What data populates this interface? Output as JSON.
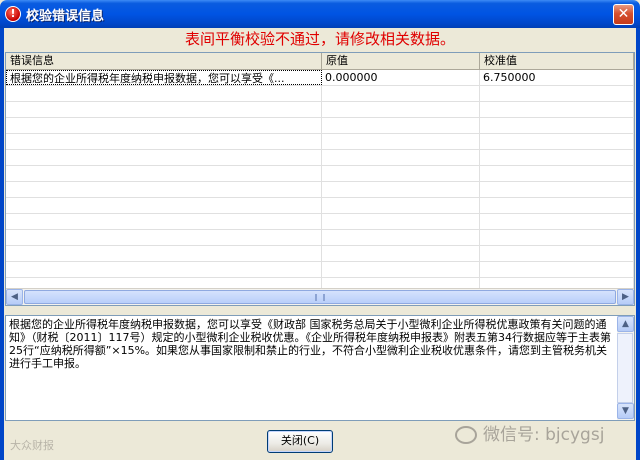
{
  "window": {
    "title": "校验错误信息",
    "icon": "error-icon",
    "close_glyph": "✕"
  },
  "headline": "表间平衡校验不通过，请修改相关数据。",
  "table": {
    "columns": [
      "错误信息",
      "原值",
      "校准值"
    ],
    "rows": [
      [
        "根据您的企业所得税年度纳税申报数据，您可以享受《...",
        "0.000000",
        "6.750000"
      ]
    ]
  },
  "scrollbar": {
    "left_glyph": "◀",
    "right_glyph": "▶",
    "up_glyph": "▲",
    "down_glyph": "▼",
    "grip": "|||"
  },
  "detail_text": "根据您的企业所得税年度纳税申报数据，您可以享受《财政部 国家税务总局关于小型微利企业所得税优惠政策有关问题的通知》（财税〔2011〕117号）规定的小型微利企业税收优惠。《企业所得税年度纳税申报表》附表五第34行数据应等于主表第25行“应纳税所得额”×15%。如果您从事国家限制和禁止的行业，不符合小型微利企业税收优惠条件，请您到主管税务机关进行手工申报。",
  "footer": {
    "close_button": "关闭(C)"
  },
  "watermarks": {
    "left": "大众财报",
    "right": "微信号: bjcygsj"
  },
  "colors": {
    "titlebar": "#0054e3",
    "headline": "#e00000",
    "face": "#ece9d8"
  }
}
